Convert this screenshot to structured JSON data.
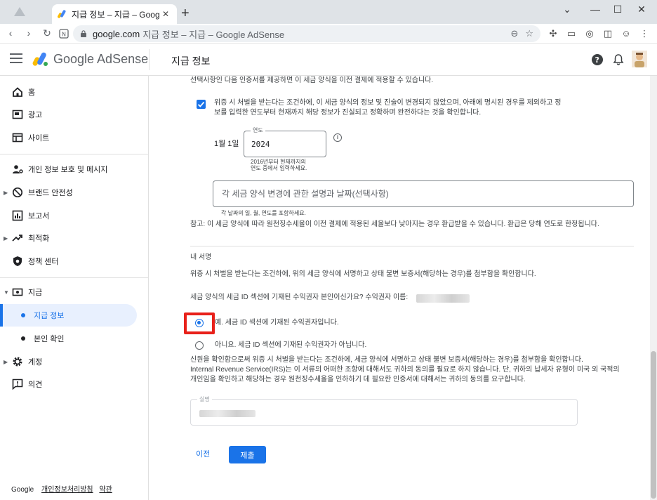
{
  "browser": {
    "tab_title": "지급 정보 – 지급 – Google AdSense",
    "url_host": "google.com",
    "url_rest": "지급 정보 – 지급 – Google AdSense",
    "window_controls": {
      "minimize": "—",
      "maximize": "☐",
      "close": "✕",
      "tabs_menu": "⌄"
    },
    "newtab": "+",
    "tab_close": "✕",
    "nav": {
      "back": "‹",
      "forward": "›",
      "reload": "↻"
    }
  },
  "header": {
    "brand": "Google AdSense",
    "page_title": "지급 정보"
  },
  "sidebar": {
    "items": [
      {
        "label": "홈",
        "icon": "home-icon"
      },
      {
        "label": "광고",
        "icon": "ads-icon"
      },
      {
        "label": "사이트",
        "icon": "sites-icon"
      },
      {
        "label": "개인 정보 보호 및 메시지",
        "icon": "privacy-icon"
      },
      {
        "label": "브랜드 안전성",
        "icon": "block-icon"
      },
      {
        "label": "보고서",
        "icon": "report-icon"
      },
      {
        "label": "최적화",
        "icon": "trending-icon"
      },
      {
        "label": "정책 센터",
        "icon": "shield-icon"
      },
      {
        "label": "지급",
        "icon": "payments-icon"
      },
      {
        "label": "지급 정보"
      },
      {
        "label": "본인 확인"
      },
      {
        "label": "계정",
        "icon": "gear-icon"
      },
      {
        "label": "의견",
        "icon": "feedback-icon"
      }
    ],
    "footer": {
      "google": "Google",
      "privacy": "개인정보처리방침",
      "terms": "약관"
    }
  },
  "form": {
    "intro": "선택사항인 다음 인증서를 제공하면 이 세금 양식을 이전 결제에 적용할 수 있습니다.",
    "checkbox_line1": "위증 시 처벌을 받는다는 조건하에, 이 세금 양식의 정보 및 진술이 변경되지 않았으며, 아래에 명시된 경우를 제외하고 정",
    "checkbox_line2": "보를 입력한 연도부터 현재까지 해당 정보가 진실되고 정확하며 완전하다는 것을 확인합니다.",
    "date_label": "1월 1일",
    "year_legend": "연도",
    "year_value": "2024",
    "year_hint_line1": "2016년부터 현재까지의",
    "year_hint_line2": "연도 중에서 입력하세요.",
    "desc_placeholder": "각 세금 양식 변경에 관한 설명과 날짜(선택사항)",
    "desc_hint": "각 날짜의 일, 월, 연도를 포함하세요.",
    "note": "참고: 이 세금 양식에 따라 원천징수세율이 이전 결제에 적용된 세율보다 낮아지는 경우 환급받을 수 있습니다. 환급은 당해 연도로 한정됩니다.",
    "signature_heading": "내 서명",
    "perjury_text": "위증 시 처벌을 받는다는 조건하에, 위의 세금 양식에 서명하고 상태 불변 보증서(해당하는 경우)를 첨부함을 확인합니다.",
    "question": "세금 양식의 세금 ID 섹션에 기재된 수익권자 본인이신가요? 수익권자 이름:",
    "radio_yes": "예. 세금 ID 섹션에 기재된 수익권자입니다.",
    "radio_no": "아니요. 세금 ID 섹션에 기재된 수익권자가 아닙니다.",
    "consent_line1": "신원을 확인함으로써 위증 시 처벌을 받는다는 조건하에, 세금 양식에 서명하고 상태 불변 보증서(해당하는 경우)를 첨부함을 확인합니다.",
    "consent_line2": "Internal Revenue Service(IRS)는 이 서류의 어떠한 조항에 대해서도 귀하의 동의를 필요로 하지 않습니다. 단, 귀하의 납세자 유형이 미국 외 국적의",
    "consent_line3": "개인임을 확인하고 해당하는 경우 원천징수세율을 인하하기 데 필요한 인증서에 대해서는 귀하의 동의를 요구합니다.",
    "signature_legend": "실명",
    "prev_button": "이전",
    "submit_button": "제출",
    "selected_option": "yes"
  },
  "colors": {
    "accent": "#1a73e8",
    "highlight": "#e8211a"
  }
}
